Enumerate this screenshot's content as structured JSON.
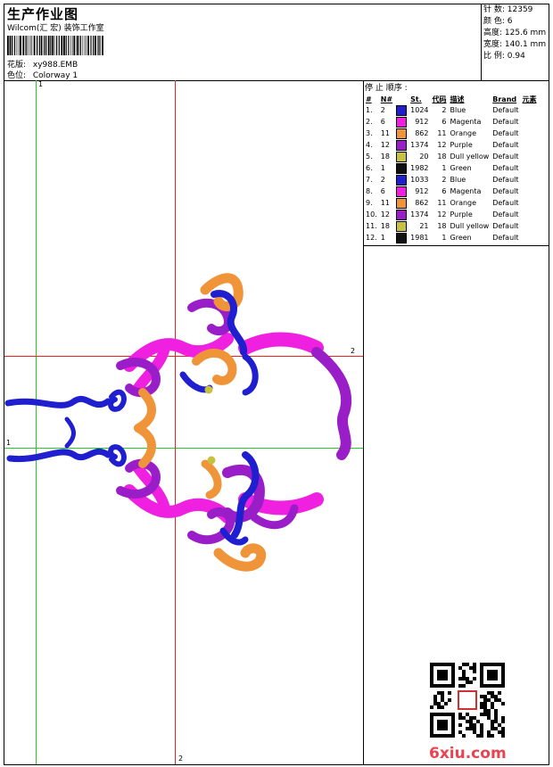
{
  "header": {
    "title": "生产作业图",
    "studio": "Wilcom(汇 宏) 装饰工作室",
    "design_label": "花版:",
    "design_value": "xy988.EMB",
    "colorway_label": "色位:",
    "colorway_value": "Colorway 1"
  },
  "stats": [
    {
      "label": "针 数:",
      "value": "12359"
    },
    {
      "label": "颜 色:",
      "value": "6"
    },
    {
      "label": "高度:",
      "value": "125.6 mm"
    },
    {
      "label": "宽度:",
      "value": "140.1 mm"
    },
    {
      "label": "比 例:",
      "value": "0.94"
    }
  ],
  "stop_sequence": {
    "title": "停 止 顺序 :",
    "columns": [
      "#",
      "N#",
      "St.",
      "代码",
      "描述",
      "Brand",
      "元素"
    ],
    "rows": [
      {
        "idx": "1.",
        "n": "2",
        "color": "#1f1fd0",
        "st": "1024",
        "code": "2",
        "desc": "Blue",
        "brand": "Default"
      },
      {
        "idx": "2.",
        "n": "6",
        "color": "#f020e0",
        "st": "912",
        "code": "6",
        "desc": "Magenta",
        "brand": "Default"
      },
      {
        "idx": "3.",
        "n": "11",
        "color": "#f0943a",
        "st": "862",
        "code": "11",
        "desc": "Orange",
        "brand": "Default"
      },
      {
        "idx": "4.",
        "n": "12",
        "color": "#9a1ec8",
        "st": "1374",
        "code": "12",
        "desc": "Purple",
        "brand": "Default"
      },
      {
        "idx": "5.",
        "n": "18",
        "color": "#c8c040",
        "st": "20",
        "code": "18",
        "desc": "Dull yellow",
        "brand": "Default"
      },
      {
        "idx": "6.",
        "n": "1",
        "color": "#101010",
        "st": "1982",
        "code": "1",
        "desc": "Green",
        "brand": "Default"
      },
      {
        "idx": "7.",
        "n": "2",
        "color": "#1f1fd0",
        "st": "1033",
        "code": "2",
        "desc": "Blue",
        "brand": "Default"
      },
      {
        "idx": "8.",
        "n": "6",
        "color": "#f020e0",
        "st": "912",
        "code": "6",
        "desc": "Magenta",
        "brand": "Default"
      },
      {
        "idx": "9.",
        "n": "11",
        "color": "#f0943a",
        "st": "862",
        "code": "11",
        "desc": "Orange",
        "brand": "Default"
      },
      {
        "idx": "10.",
        "n": "12",
        "color": "#9a1ec8",
        "st": "1374",
        "code": "12",
        "desc": "Purple",
        "brand": "Default"
      },
      {
        "idx": "11.",
        "n": "18",
        "color": "#c8c040",
        "st": "21",
        "code": "18",
        "desc": "Dull yellow",
        "brand": "Default"
      },
      {
        "idx": "12.",
        "n": "1",
        "color": "#101010",
        "st": "1981",
        "code": "1",
        "desc": "Green",
        "brand": "Default"
      }
    ]
  },
  "guides": {
    "green_label_1": "1",
    "green_label_2": "1",
    "red_label_1": "2",
    "red_label_2": "2"
  },
  "watermark": {
    "site": "6xiu.com"
  },
  "colors": {
    "guide_green": "#22cc22",
    "guide_red": "#ee2222",
    "blue": "#1f1fd0",
    "magenta": "#f020e0",
    "orange": "#f0943a",
    "purple": "#9a1ec8"
  }
}
